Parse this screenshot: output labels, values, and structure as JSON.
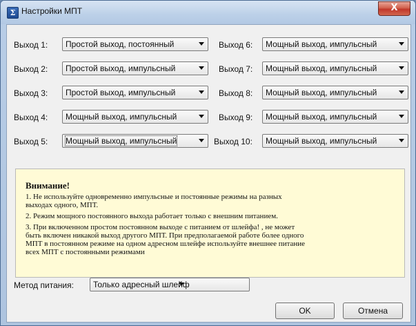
{
  "window": {
    "title": "Настройки МПТ",
    "close_glyph": "X",
    "app_icon_glyph": "Σ"
  },
  "outputs_left": [
    {
      "label": "Выход 1:",
      "value": "Простой выход, постоянный"
    },
    {
      "label": "Выход 2:",
      "value": "Простой выход, импульсный"
    },
    {
      "label": "Выход 3:",
      "value": "Простой выход, импульсный"
    },
    {
      "label": "Выход 4:",
      "value": "Мощный выход, импульсный"
    },
    {
      "label": "Выход 5:",
      "value": "Мощный выход, импульсный"
    }
  ],
  "outputs_right": [
    {
      "label": "Выход 6:",
      "value": "Мощный выход, импульсный"
    },
    {
      "label": "Выход 7:",
      "value": "Мощный выход, импульсный"
    },
    {
      "label": "Выход 8:",
      "value": "Мощный выход, импульсный"
    },
    {
      "label": "Выход 9:",
      "value": "Мощный выход, импульсный"
    },
    {
      "label": "Выход 10:",
      "value": "Мощный выход, импульсный"
    }
  ],
  "warning": {
    "title": "Внимание!",
    "lines": [
      "1. Не используйте одновременно импульсные и постоянные режимы на разных",
      "выходах одного, МПТ.",
      "2. Режим мощного постоянного выхода работает только с внешним питанием.",
      "3. При включенном простом постоянном выходе с питанием от шлейфа! , не может",
      "быть включен никакой выход другого МПТ. При предполагаемой работе более одного",
      "МПТ в постоянном режиме на одном адресном шлейфе используйте внешнее питание",
      "всех МПТ с постоянными режимами"
    ]
  },
  "power": {
    "label": "Метод питания:",
    "value": "Только адресный шлейф"
  },
  "buttons": {
    "ok": "OK",
    "cancel": "Отмена"
  }
}
